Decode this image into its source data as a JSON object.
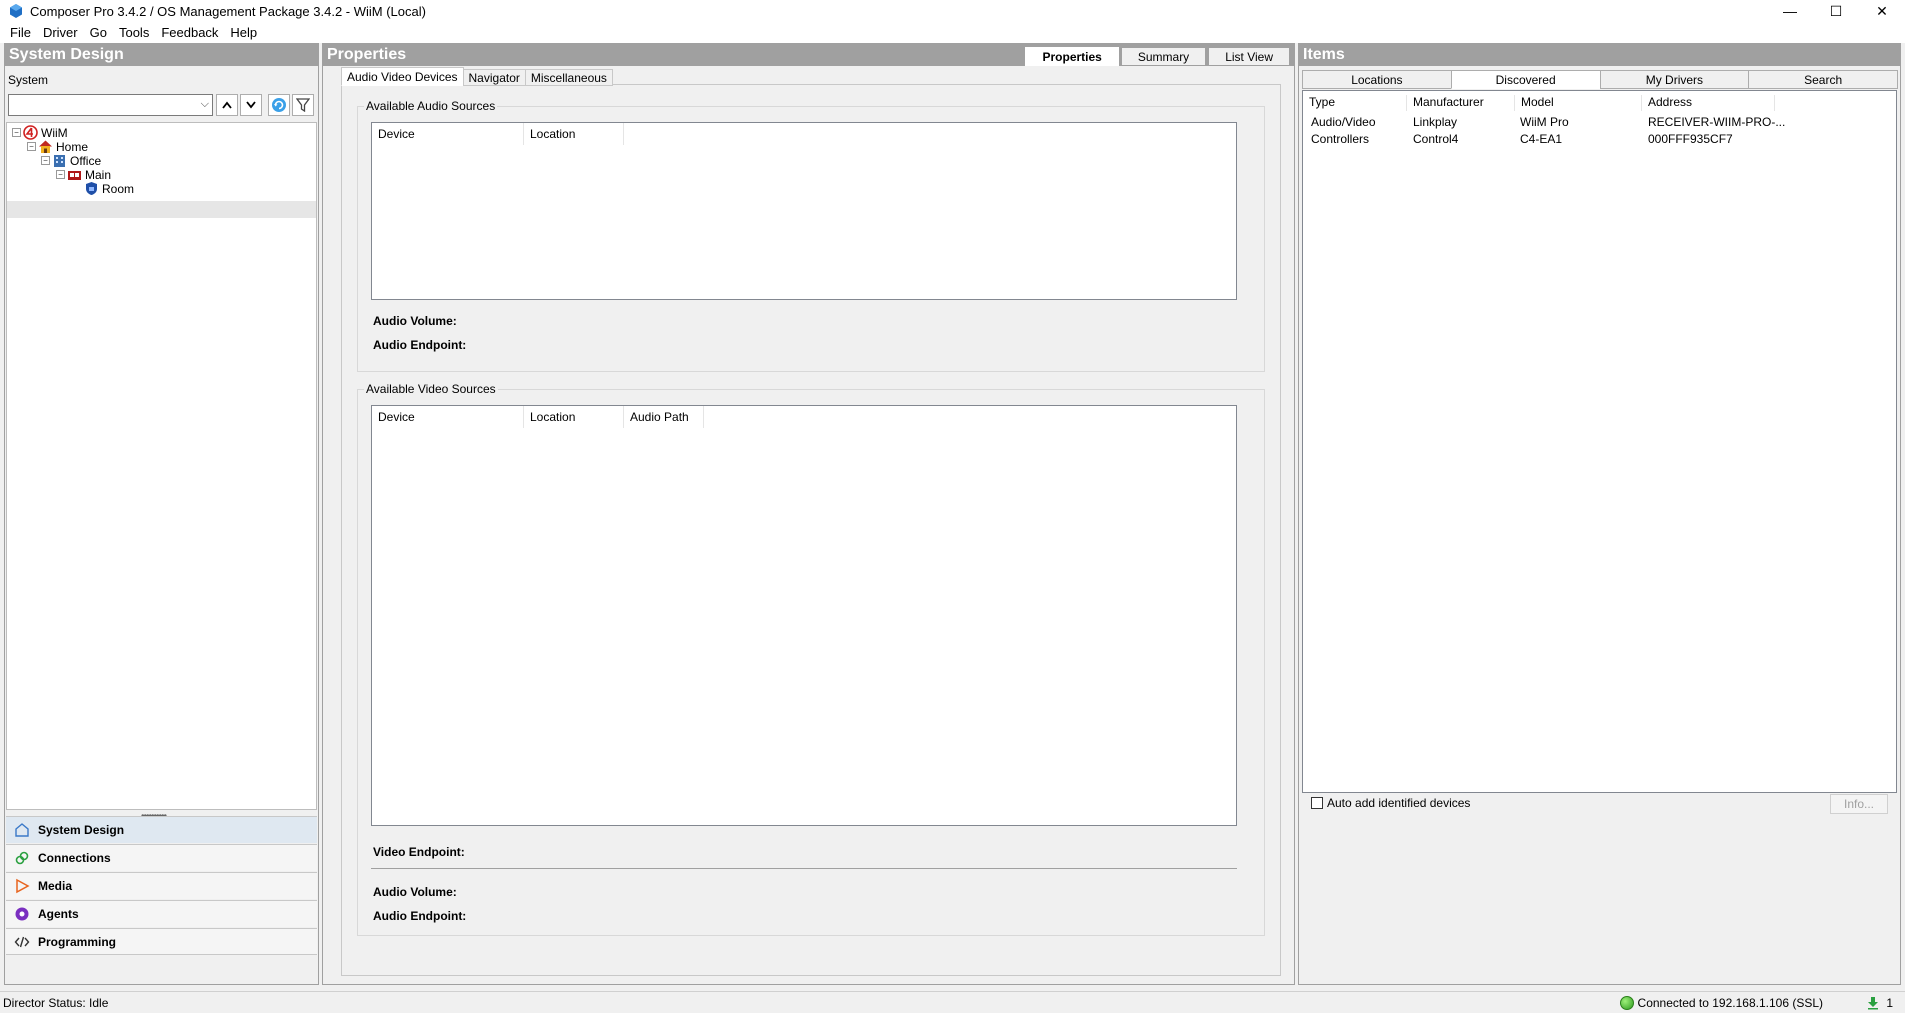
{
  "window": {
    "title": "Composer Pro 3.4.2 / OS Management Package 3.4.2 - WiiM (Local)",
    "minimize": "—",
    "maximize": "☐",
    "close": "✕"
  },
  "menu": [
    "File",
    "Driver",
    "Go",
    "Tools",
    "Feedback",
    "Help"
  ],
  "left": {
    "header": "System Design",
    "system_label": "System",
    "tree": [
      "WiiM",
      "Home",
      "Office",
      "Main",
      "Room"
    ],
    "nav": [
      "System Design",
      "Connections",
      "Media",
      "Agents",
      "Programming"
    ]
  },
  "middle": {
    "header": "Properties",
    "tabs": [
      "Properties",
      "Summary",
      "List View"
    ],
    "subtabs": [
      "Audio Video Devices",
      "Navigator",
      "Miscellaneous"
    ],
    "audio_group": {
      "title": "Available Audio Sources",
      "columns": [
        "Device",
        "Location"
      ],
      "volume_label": "Audio Volume:",
      "endpoint_label": "Audio Endpoint:"
    },
    "video_group": {
      "title": "Available Video Sources",
      "columns": [
        "Device",
        "Location",
        "Audio Path"
      ],
      "video_endpoint_label": "Video Endpoint:",
      "volume_label": "Audio Volume:",
      "endpoint_label": "Audio Endpoint:"
    }
  },
  "right": {
    "header": "Items",
    "tabs": [
      "Locations",
      "Discovered",
      "My Drivers",
      "Search"
    ],
    "columns": [
      "Type",
      "Manufacturer",
      "Model",
      "Address"
    ],
    "rows": [
      [
        "Audio/Video",
        "Linkplay",
        "WiiM Pro",
        "RECEIVER-WIIM-PRO-..."
      ],
      [
        "Controllers",
        "Control4",
        "C4-EA1",
        "000FFF935CF7"
      ]
    ],
    "auto_add": "Auto add identified devices",
    "info_button": "Info..."
  },
  "status": {
    "director": "Director Status: Idle",
    "connection": "Connected to 192.168.1.106 (SSL)",
    "download_count": "1"
  }
}
